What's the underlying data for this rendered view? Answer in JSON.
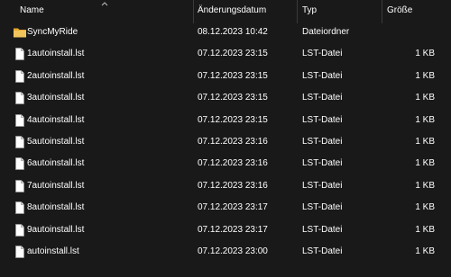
{
  "columns": {
    "name": "Name",
    "date": "Änderungsdatum",
    "type": "Typ",
    "size": "Größe"
  },
  "rows": [
    {
      "name": "SyncMyRide",
      "date": "08.12.2023 10:42",
      "type": "Dateiordner",
      "size": "",
      "icon": "folder-icon"
    },
    {
      "name": "1autoinstall.lst",
      "date": "07.12.2023 23:15",
      "type": "LST-Datei",
      "size": "1 KB",
      "icon": "file-icon"
    },
    {
      "name": "2autoinstall.lst",
      "date": "07.12.2023 23:15",
      "type": "LST-Datei",
      "size": "1 KB",
      "icon": "file-icon"
    },
    {
      "name": "3autoinstall.lst",
      "date": "07.12.2023 23:15",
      "type": "LST-Datei",
      "size": "1 KB",
      "icon": "file-icon"
    },
    {
      "name": "4autoinstall.lst",
      "date": "07.12.2023 23:15",
      "type": "LST-Datei",
      "size": "1 KB",
      "icon": "file-icon"
    },
    {
      "name": "5autoinstall.lst",
      "date": "07.12.2023 23:16",
      "type": "LST-Datei",
      "size": "1 KB",
      "icon": "file-icon"
    },
    {
      "name": "6autoinstall.lst",
      "date": "07.12.2023 23:16",
      "type": "LST-Datei",
      "size": "1 KB",
      "icon": "file-icon"
    },
    {
      "name": "7autoinstall.lst",
      "date": "07.12.2023 23:16",
      "type": "LST-Datei",
      "size": "1 KB",
      "icon": "file-icon"
    },
    {
      "name": "8autoinstall.lst",
      "date": "07.12.2023 23:17",
      "type": "LST-Datei",
      "size": "1 KB",
      "icon": "file-icon"
    },
    {
      "name": "9autoinstall.lst",
      "date": "07.12.2023 23:17",
      "type": "LST-Datei",
      "size": "1 KB",
      "icon": "file-icon"
    },
    {
      "name": "autoinstall.lst",
      "date": "07.12.2023 23:00",
      "type": "LST-Datei",
      "size": "1 KB",
      "icon": "file-icon"
    }
  ],
  "colors": {
    "background": "#191919",
    "text": "#ffffff",
    "divider": "#3a3a3a",
    "folder": "#f2c55c"
  }
}
